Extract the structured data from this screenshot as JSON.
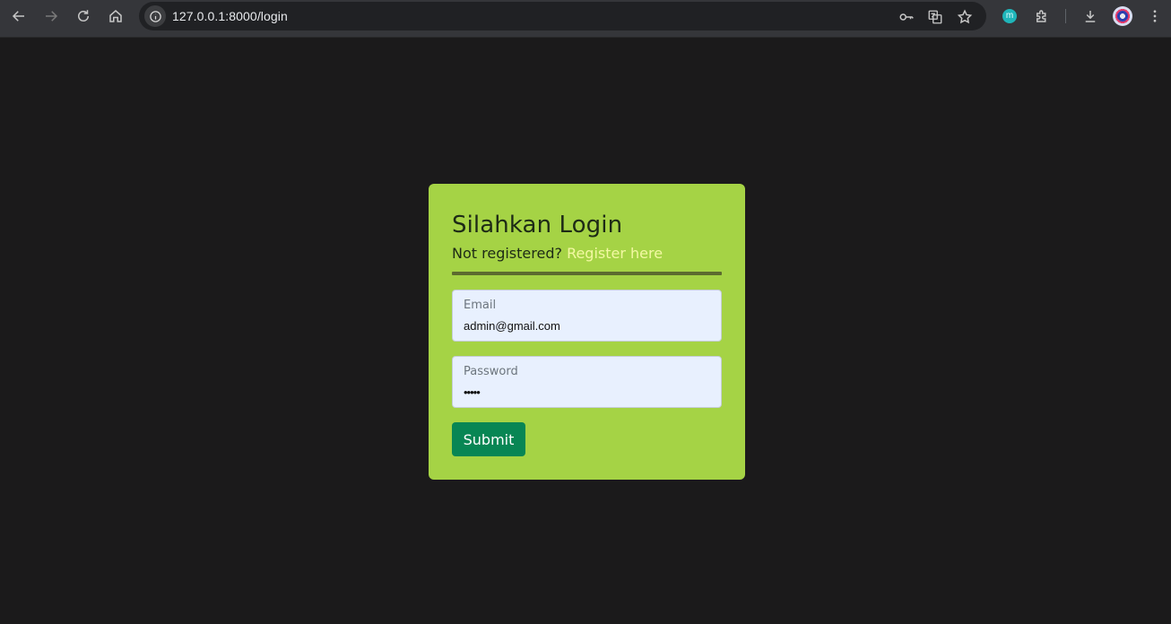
{
  "browser": {
    "url": "127.0.0.1:8000/login",
    "extension_badge": "m"
  },
  "login": {
    "title": "Silahkan Login",
    "subtitle_prefix": "Not registered?",
    "register_link": "Register here",
    "email_label": "Email",
    "email_value": "admin@gmail.com",
    "password_label": "Password",
    "password_value": "•••••",
    "submit_label": "Submit"
  },
  "colors": {
    "page_background": "#1b1a1b",
    "card_background": "#a5d345",
    "link": "#f3f8a3",
    "input_background": "#e8f0fe",
    "submit_background": "#088654"
  }
}
